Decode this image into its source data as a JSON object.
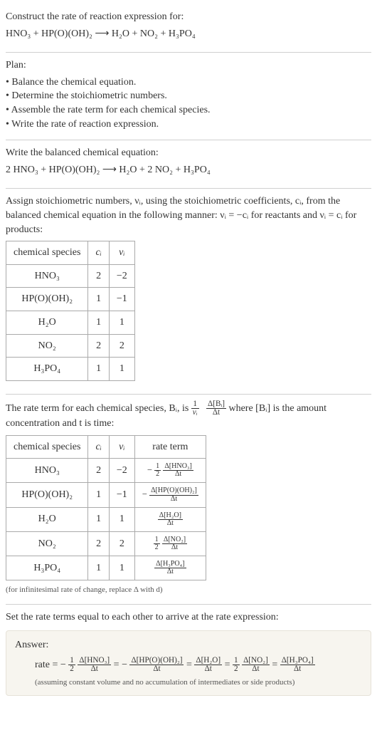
{
  "intro": {
    "title": "Construct the rate of reaction expression for:",
    "equation": "HNO₃ + HP(O)(OH)₂  ⟶  H₂O + NO₂ + H₃PO₄"
  },
  "plan": {
    "heading": "Plan:",
    "items": [
      "Balance the chemical equation.",
      "Determine the stoichiometric numbers.",
      "Assemble the rate term for each chemical species.",
      "Write the rate of reaction expression."
    ]
  },
  "balanced": {
    "heading": "Write the balanced chemical equation:",
    "equation": "2 HNO₃ + HP(O)(OH)₂  ⟶  H₂O + 2 NO₂ + H₃PO₄"
  },
  "assign": {
    "text1": "Assign stoichiometric numbers, νᵢ, using the stoichiometric coefficients, cᵢ, from the balanced chemical equation in the following manner: νᵢ = −cᵢ for reactants and νᵢ = cᵢ for products:",
    "table": {
      "headers": [
        "chemical species",
        "cᵢ",
        "νᵢ"
      ],
      "rows": [
        [
          "HNO₃",
          "2",
          "−2"
        ],
        [
          "HP(O)(OH)₂",
          "1",
          "−1"
        ],
        [
          "H₂O",
          "1",
          "1"
        ],
        [
          "NO₂",
          "2",
          "2"
        ],
        [
          "H₃PO₄",
          "1",
          "1"
        ]
      ]
    }
  },
  "rateterm": {
    "text_a": "The rate term for each chemical species, Bᵢ, is ",
    "text_b": " where [Bᵢ] is the amount concentration and t is time:",
    "table": {
      "headers": [
        "chemical species",
        "cᵢ",
        "νᵢ",
        "rate term"
      ],
      "rows": [
        {
          "sp": "HNO₃",
          "c": "2",
          "v": "−2",
          "neg": true,
          "coef_num": "1",
          "coef_den": "2",
          "d_num": "Δ[HNO₃]",
          "d_den": "Δt"
        },
        {
          "sp": "HP(O)(OH)₂",
          "c": "1",
          "v": "−1",
          "neg": true,
          "coef_num": "",
          "coef_den": "",
          "d_num": "Δ[HP(O)(OH)₂]",
          "d_den": "Δt"
        },
        {
          "sp": "H₂O",
          "c": "1",
          "v": "1",
          "neg": false,
          "coef_num": "",
          "coef_den": "",
          "d_num": "Δ[H₂O]",
          "d_den": "Δt"
        },
        {
          "sp": "NO₂",
          "c": "2",
          "v": "2",
          "neg": false,
          "coef_num": "1",
          "coef_den": "2",
          "d_num": "Δ[NO₂]",
          "d_den": "Δt"
        },
        {
          "sp": "H₃PO₄",
          "c": "1",
          "v": "1",
          "neg": false,
          "coef_num": "",
          "coef_den": "",
          "d_num": "Δ[H₃PO₄]",
          "d_den": "Δt"
        }
      ]
    },
    "note": "(for infinitesimal rate of change, replace Δ with d)"
  },
  "setequal": {
    "text": "Set the rate terms equal to each other to arrive at the rate expression:"
  },
  "answer": {
    "heading": "Answer:",
    "prefix": "rate = ",
    "terms": [
      {
        "neg": true,
        "coef_num": "1",
        "coef_den": "2",
        "d_num": "Δ[HNO₃]",
        "d_den": "Δt"
      },
      {
        "neg": true,
        "coef_num": "",
        "coef_den": "",
        "d_num": "Δ[HP(O)(OH)₂]",
        "d_den": "Δt"
      },
      {
        "neg": false,
        "coef_num": "",
        "coef_den": "",
        "d_num": "Δ[H₂O]",
        "d_den": "Δt"
      },
      {
        "neg": false,
        "coef_num": "1",
        "coef_den": "2",
        "d_num": "Δ[NO₂]",
        "d_den": "Δt"
      },
      {
        "neg": false,
        "coef_num": "",
        "coef_den": "",
        "d_num": "Δ[H₃PO₄]",
        "d_den": "Δt"
      }
    ],
    "note": "(assuming constant volume and no accumulation of intermediates or side products)"
  },
  "mathbits": {
    "one_over_nu_num": "1",
    "one_over_nu_den": "νᵢ",
    "dBi_num": "Δ[Bᵢ]",
    "dBi_den": "Δt"
  }
}
